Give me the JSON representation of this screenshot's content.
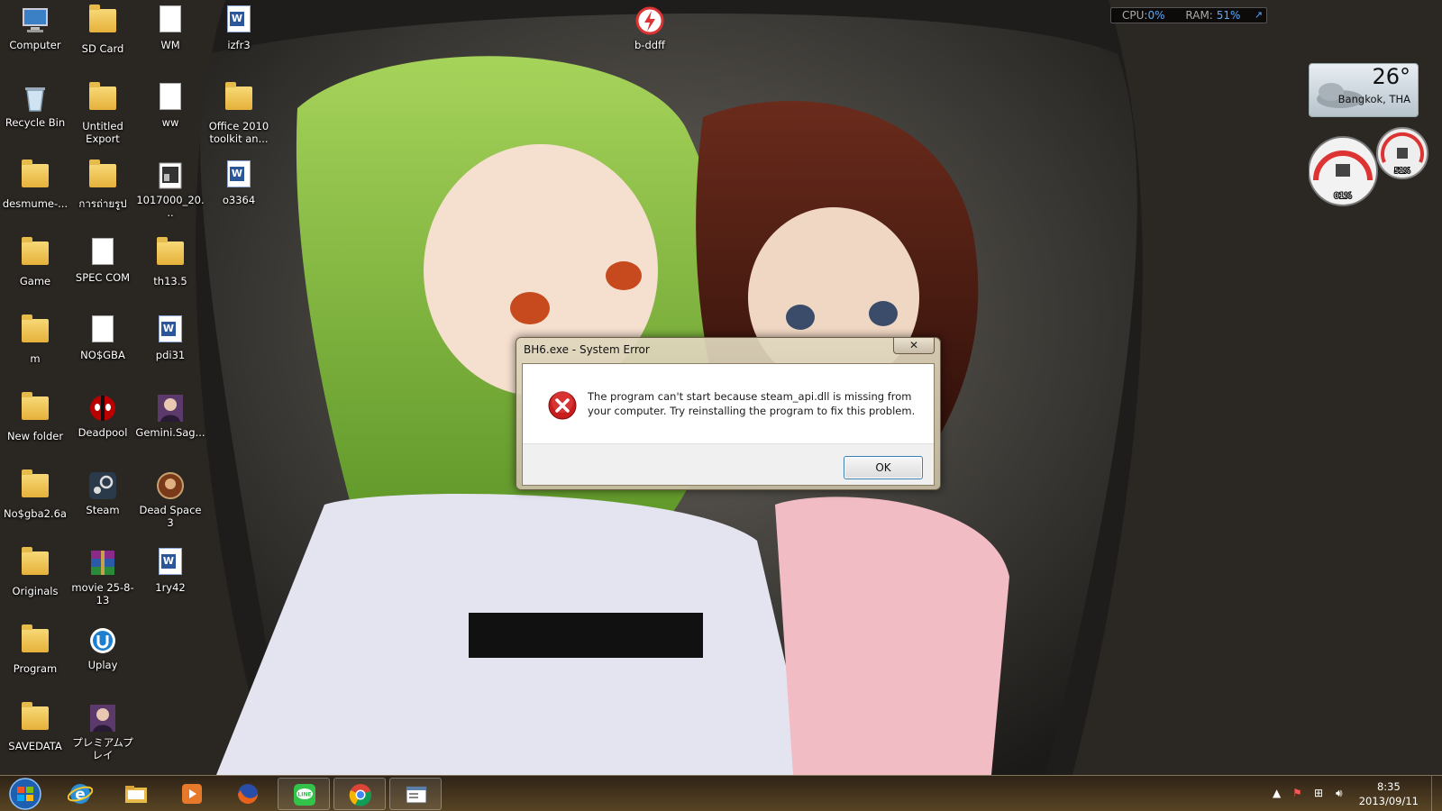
{
  "desktop": {
    "col1": [
      {
        "label": "Computer",
        "icon": "computer-icon"
      },
      {
        "label": "Recycle Bin",
        "icon": "recycle-bin-icon"
      },
      {
        "label": "desmume-...",
        "icon": "folder-icon"
      },
      {
        "label": "Game",
        "icon": "folder-icon"
      },
      {
        "label": "m",
        "icon": "folder-icon"
      },
      {
        "label": "New folder",
        "icon": "folder-icon"
      },
      {
        "label": "No$gba2.6a",
        "icon": "folder-icon"
      },
      {
        "label": "Originals",
        "icon": "folder-icon"
      },
      {
        "label": "Program",
        "icon": "folder-icon"
      },
      {
        "label": "SAVEDATA",
        "icon": "folder-icon"
      }
    ],
    "col2": [
      {
        "label": "SD Card",
        "icon": "folder-icon"
      },
      {
        "label": "Untitled Export",
        "icon": "folder-icon"
      },
      {
        "label": "การถ่ายรูป",
        "icon": "folder-icon"
      },
      {
        "label": "SPEC COM",
        "icon": "document-icon"
      },
      {
        "label": "NO$GBA",
        "icon": "document-icon"
      },
      {
        "label": "Deadpool",
        "icon": "deadpool-icon"
      },
      {
        "label": "Steam",
        "icon": "steam-icon"
      },
      {
        "label": "movie 25-8-13",
        "icon": "winrar-icon"
      },
      {
        "label": "Uplay",
        "icon": "uplay-icon"
      },
      {
        "label": "プレミアムプレイ",
        "icon": "game-character-icon"
      }
    ],
    "col3": [
      {
        "label": "WM",
        "icon": "document-icon"
      },
      {
        "label": "ww",
        "icon": "document-icon"
      },
      {
        "label": "1017000_20...",
        "icon": "image-file-icon"
      },
      {
        "label": "th13.5",
        "icon": "folder-icon"
      },
      {
        "label": "pdi31",
        "icon": "word-document-icon"
      },
      {
        "label": "Gemini.Sag...",
        "icon": "game-character-icon"
      },
      {
        "label": "Dead Space 3",
        "icon": "dead-space-icon"
      },
      {
        "label": "1ry42",
        "icon": "word-document-icon"
      }
    ],
    "col4": [
      {
        "label": "izfr3",
        "icon": "word-document-icon"
      },
      {
        "label": "Office 2010 toolkit an...",
        "icon": "folder-icon"
      },
      {
        "label": "o3364",
        "icon": "word-document-icon"
      }
    ],
    "extra": {
      "label": "b-ddff",
      "icon": "app-icon"
    }
  },
  "gadgets": {
    "cpu_label": "CPU:",
    "cpu_value": "0%",
    "ram_label": "RAM:",
    "ram_value": "51%",
    "weather_temp": "26°",
    "weather_city": "Bangkok, THA",
    "meter_cpu": "01%",
    "meter_ram": "51%"
  },
  "dialog": {
    "title": "BH6.exe - System Error",
    "close": "✕",
    "message": "The program can't start because steam_api.dll is missing from your computer. Try reinstalling the program to fix this problem.",
    "ok_label": "OK"
  },
  "taskbar": {
    "buttons": [
      {
        "name": "internet-explorer-icon",
        "pinned": false
      },
      {
        "name": "file-explorer-icon",
        "pinned": false
      },
      {
        "name": "media-player-icon",
        "pinned": false
      },
      {
        "name": "firefox-icon",
        "pinned": false
      },
      {
        "name": "line-app-icon",
        "pinned": true
      },
      {
        "name": "chrome-icon",
        "pinned": true
      },
      {
        "name": "error-window-icon",
        "pinned": true
      }
    ],
    "time": "8:35",
    "date": "2013/09/11"
  }
}
